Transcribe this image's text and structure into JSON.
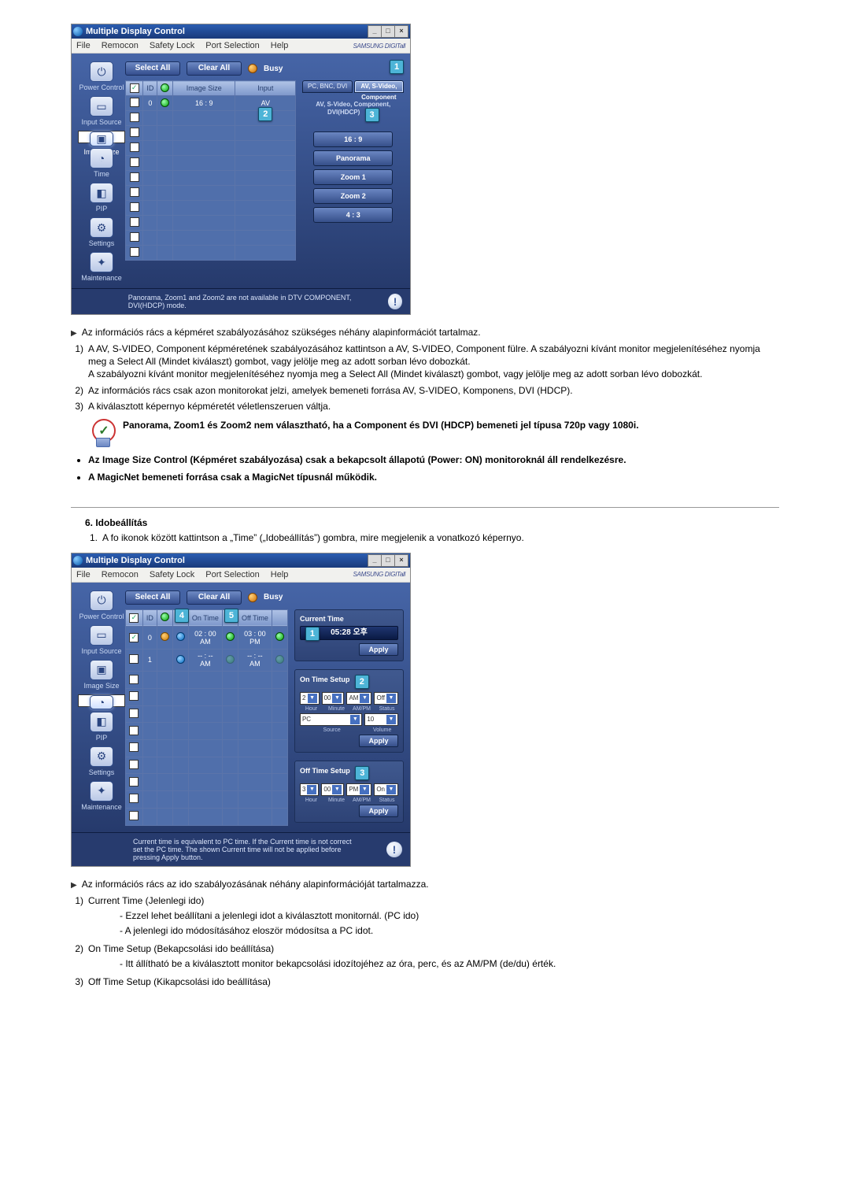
{
  "titlebar": "Multiple Display Control",
  "menus": {
    "file": "File",
    "remocon": "Remocon",
    "safety": "Safety Lock",
    "port": "Port Selection",
    "help": "Help"
  },
  "brand": "SAMSUNG DIGITall",
  "toolbar": {
    "select_all": "Select All",
    "clear_all": "Clear All",
    "busy": "Busy"
  },
  "sidebar": {
    "power": "Power Control",
    "input": "Input Source",
    "imagesize": "Image Size",
    "time": "Time",
    "pip": "PIP",
    "settings": "Settings",
    "maintenance": "Maintenance"
  },
  "shot1": {
    "cols": {
      "id": "ID",
      "imgsize": "Image Size",
      "input": "Input"
    },
    "row": {
      "id": "0",
      "imgsize": "16 : 9",
      "input": "AV"
    },
    "tabs": {
      "left": "PC, BNC, DVI",
      "right": "AV, S-Video, Component"
    },
    "subheader": "AV, S-Video, Component, DVI(HDCP)",
    "opts": {
      "a": "16 : 9",
      "b": "Panorama",
      "c": "Zoom 1",
      "d": "Zoom 2",
      "e": "4 : 3"
    },
    "footer": "Panorama, Zoom1 and Zoom2 are not available in DTV COMPONENT, DVI(HDCP) mode.",
    "callout1": "1",
    "callout2": "2",
    "callout3": "3"
  },
  "shot2": {
    "cols": {
      "id": "ID",
      "on": "On Time",
      "off": "Off Time"
    },
    "rows": [
      {
        "id": "0",
        "st1": "orange",
        "st2": "blue",
        "on": "02 : 00  AM",
        "onDot": true,
        "off": "03 : 00  PM",
        "offDot": true
      },
      {
        "id": "1",
        "st1": "",
        "st2": "blue",
        "on": "-- : --  AM",
        "onDot": false,
        "off": "-- : --  AM",
        "offDot": false
      }
    ],
    "panel_current_title": "Current Time",
    "panel_current_value": "05:28 오후",
    "panel_on_title": "On Time Setup",
    "panel_off_title": "Off Time Setup",
    "apply": "Apply",
    "lbls": {
      "hour": "Hour",
      "minute": "Minute",
      "ampm": "AM/PM",
      "source": "Source",
      "volume": "Volume",
      "status": "Status"
    },
    "on_vals": {
      "hour": "2",
      "minute": "00",
      "ampm": "AM",
      "status": "Off",
      "source": "PC",
      "volume": "10"
    },
    "off_vals": {
      "hour": "3",
      "minute": "00",
      "ampm": "PM",
      "status": "On"
    },
    "footer": "Current time is equivalent to PC time. If the Current time is not correct set the PC time. The shown Current time will not be applied before pressing Apply button.",
    "c1": "1",
    "c2": "2",
    "c3": "3",
    "c4": "4",
    "c5": "5"
  },
  "doc1": {
    "intro": "Az információs rács a képméret szabályozásához szükséges néhány alapinformációt tartalmaz.",
    "p1a": "A AV, S-VIDEO, Component képméretének szabályozásához kattintson a AV, S-VIDEO, Component fülre. A szabályozni kívánt monitor megjelenítéséhez nyomja meg a Select All (Mindet kiválaszt) gombot, vagy jelölje meg az adott sorban lévo dobozkát.",
    "p1b": "A szabályozni kívánt monitor megjelenítéséhez nyomja meg a Select All (Mindet kiválaszt) gombot, vagy jelölje meg az adott sorban lévo dobozkát.",
    "p2": "Az információs rács csak azon monitorokat jelzi, amelyek bemeneti forrása AV, S-VIDEO, Komponens, DVI (HDCP).",
    "p3": "A kiválasztott képernyo képméretét véletlenszeruen váltja.",
    "note": "Panorama, Zoom1 és Zoom2 nem választható, ha a Component és DVI (HDCP) bemeneti jel típusa 720p vagy 1080i.",
    "b1": "Az Image Size Control (Képméret szabályozása) csak a bekapcsolt állapotú (Power: ON) monitoroknál áll rendelkezésre.",
    "b2": "A MagicNet bemeneti forrása csak a MagicNet típusnál működik."
  },
  "doc2": {
    "sectitle": "6. Idobeállítás",
    "step": "A fo ikonok között kattintson a „Time” („Idobeállítás”) gombra, mire megjelenik a vonatkozó képernyo.",
    "intro": "Az információs rács az ido szabályozásának néhány alapinformációját tartalmazza.",
    "p1": "Current Time (Jelenlegi ido)",
    "p1a": "Ezzel lehet beállítani a jelenlegi idot a kiválasztott monitornál. (PC ido)",
    "p1b": "A jelenlegi ido módosításához eloször módosítsa a PC idot.",
    "p2": "On Time Setup (Bekapcsolási ido beállítása)",
    "p2a": "Itt állítható be a kiválasztott monitor bekapcsolási idozítojéhez az óra, perc, és az AM/PM (de/du) érték.",
    "p3": "Off Time Setup (Kikapcsolási ido beállítása)"
  }
}
